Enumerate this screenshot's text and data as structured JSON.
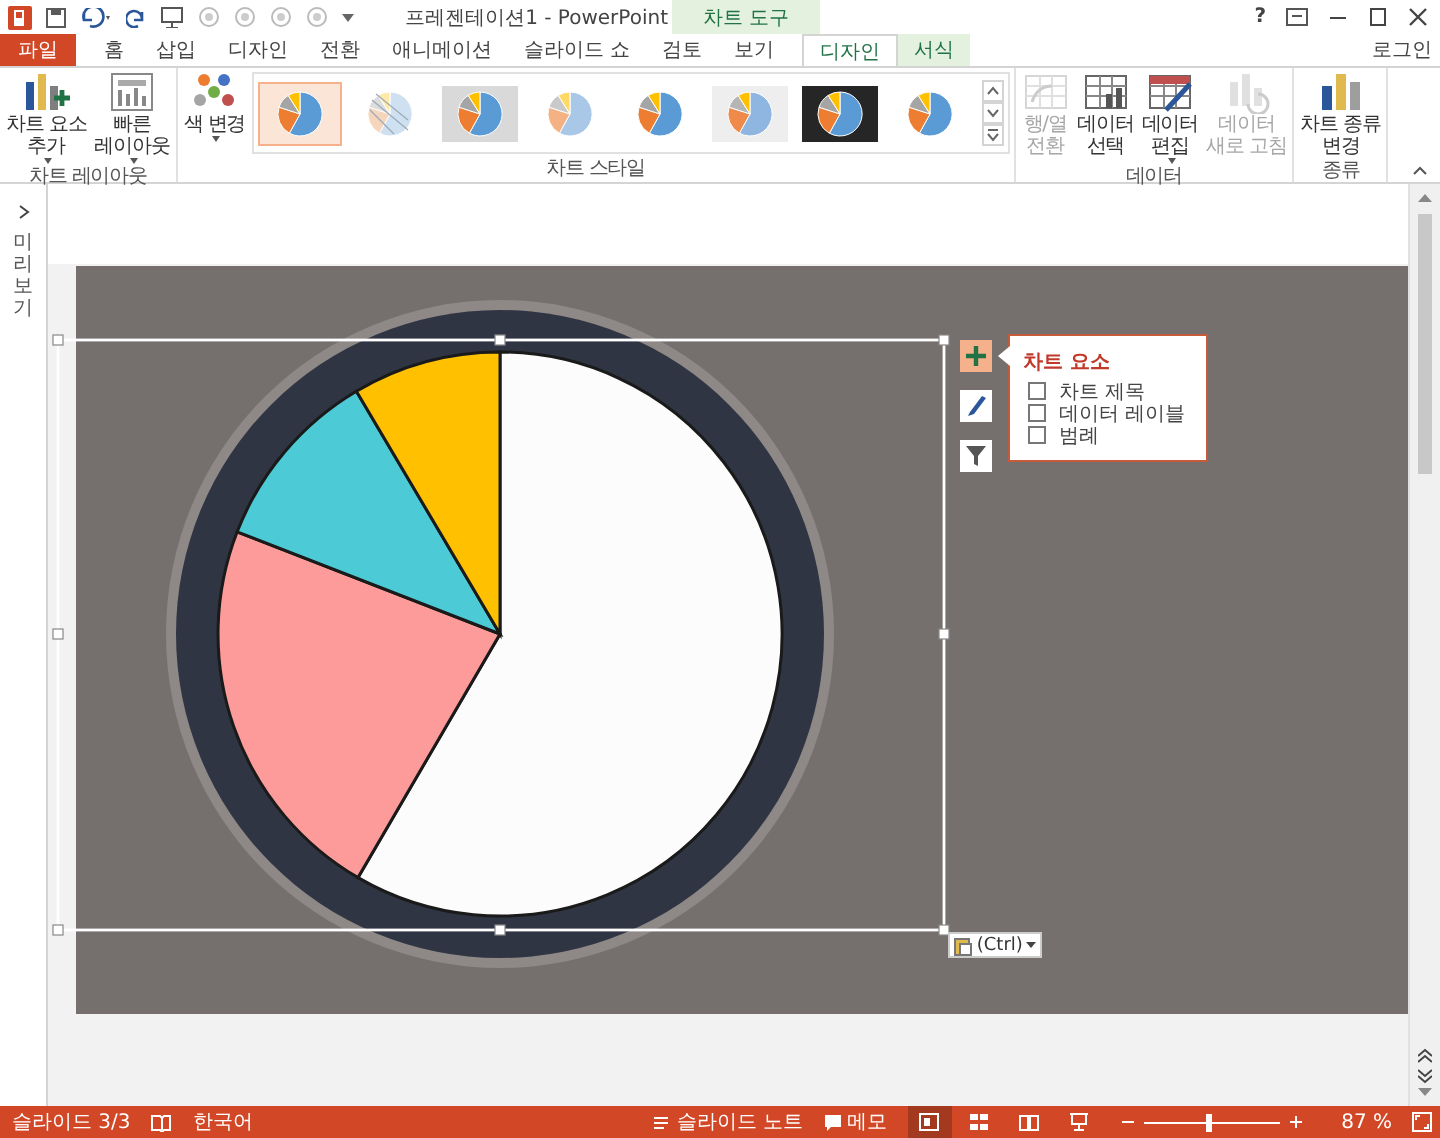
{
  "title_bar": {
    "title": "프레젠테이션1 - PowerPoint",
    "contextual_group": "차트 도구",
    "help": "?",
    "sign_in": "로그인"
  },
  "tabs": [
    {
      "label": "파일",
      "kind": "file",
      "selected": false
    },
    {
      "label": "홈",
      "kind": "normal",
      "selected": false
    },
    {
      "label": "삽입",
      "kind": "normal",
      "selected": false
    },
    {
      "label": "디자인",
      "kind": "normal",
      "selected": false
    },
    {
      "label": "전환",
      "kind": "normal",
      "selected": false
    },
    {
      "label": "애니메이션",
      "kind": "normal",
      "selected": false
    },
    {
      "label": "슬라이드 쇼",
      "kind": "normal",
      "selected": false
    },
    {
      "label": "검토",
      "kind": "normal",
      "selected": false
    },
    {
      "label": "보기",
      "kind": "normal",
      "selected": false
    },
    {
      "label": "디자인",
      "kind": "context",
      "selected": true
    },
    {
      "label": "서식",
      "kind": "context",
      "selected": false
    }
  ],
  "ribbon": {
    "groups": [
      {
        "label": "차트 레이아웃",
        "buttons": [
          {
            "label": "차트 요소\n추가",
            "menu": true,
            "disabled": false
          },
          {
            "label": "빠른\n레이아웃",
            "menu": true,
            "disabled": false
          }
        ]
      },
      {
        "label": "차트 스타일",
        "buttons": [
          {
            "label": "색 변경",
            "menu": true,
            "disabled": false
          }
        ],
        "gallery": [
          {
            "selected": true
          },
          {
            "selected": false
          },
          {
            "selected": false
          },
          {
            "selected": false
          },
          {
            "selected": false
          },
          {
            "selected": false
          },
          {
            "selected": false
          },
          {
            "selected": false
          }
        ]
      },
      {
        "label": "데이터",
        "buttons": [
          {
            "label": "행/열\n전환",
            "menu": false,
            "disabled": true
          },
          {
            "label": "데이터\n선택",
            "menu": false,
            "disabled": false
          },
          {
            "label": "데이터\n편집",
            "menu": true,
            "disabled": false
          },
          {
            "label": "데이터\n새로 고침",
            "menu": false,
            "disabled": true
          }
        ]
      },
      {
        "label": "종류",
        "buttons": [
          {
            "label": "차트 종류\n변경",
            "menu": false,
            "disabled": false
          }
        ]
      }
    ]
  },
  "thumbnails_pane": {
    "label": "미리 보기"
  },
  "chart_popup": {
    "title": "차트 요소",
    "items": [
      {
        "label": "차트 제목",
        "checked": false
      },
      {
        "label": "데이터 레이블",
        "checked": false
      },
      {
        "label": "범례",
        "checked": false
      }
    ]
  },
  "paste_options": {
    "label": "(Ctrl)"
  },
  "status_bar": {
    "slide": "슬라이드 3/3",
    "language": "한국어",
    "notes": "슬라이드 노트",
    "comments": "메모",
    "views": [
      {
        "selected": true
      },
      {
        "selected": false
      },
      {
        "selected": false
      },
      {
        "selected": false
      }
    ],
    "zoom": {
      "level": 0.47,
      "reading": "87 %"
    }
  }
}
